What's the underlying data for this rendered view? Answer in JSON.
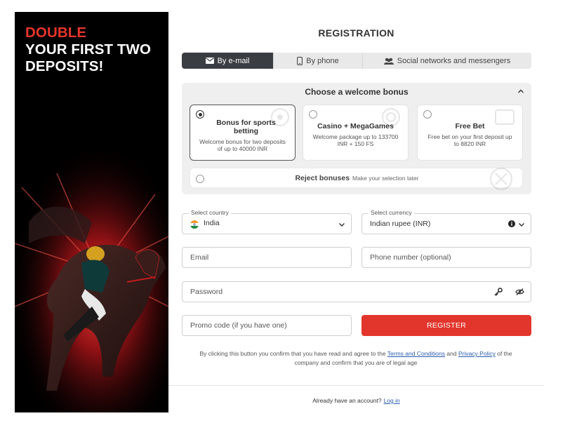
{
  "promo": {
    "line1": "DOUBLE",
    "line2": "YOUR FIRST TWO",
    "line3": "DEPOSITS!"
  },
  "title": "REGISTRATION",
  "tabs": [
    {
      "label": "By e-mail",
      "icon": "envelope-icon",
      "active": true
    },
    {
      "label": "By phone",
      "icon": "phone-icon",
      "active": false
    },
    {
      "label": "Social networks and messengers",
      "icon": "people-icon",
      "active": false
    }
  ],
  "bonus": {
    "header": "Choose a welcome bonus",
    "options": [
      {
        "title": "Bonus for sports betting",
        "desc": "Welcome bonus for two deposits of up to 40000 INR",
        "selected": true
      },
      {
        "title": "Casino + MegaGames",
        "desc": "Welcome package up to 133700 INR + 150 FS",
        "selected": false
      },
      {
        "title": "Free Bet",
        "desc": "Free bet on your first deposit up to 8820 INR",
        "selected": false
      }
    ],
    "reject_title": "Reject bonuses",
    "reject_sub": "Make your selection later"
  },
  "form": {
    "country_label": "Select country",
    "country_value": "India",
    "currency_label": "Select currency",
    "currency_value": "Indian rupee (INR)",
    "email_placeholder": "Email",
    "phone_placeholder": "Phone number (optional)",
    "password_placeholder": "Password",
    "promo_placeholder": "Promo code (if you have one)",
    "register_label": "REGISTER"
  },
  "legal": {
    "part1": "By clicking this button you confirm that you have read and agree to the",
    "terms": "Terms and Conditions",
    "and": "and",
    "privacy": "Privacy Policy",
    "part2": "of the company and confirm that you are of legal age"
  },
  "login": {
    "prompt": "Already have an account?",
    "link": "Log in"
  },
  "colors": {
    "accent": "#e2362d",
    "tab_active": "#3a3d42",
    "link": "#2a5db0"
  }
}
